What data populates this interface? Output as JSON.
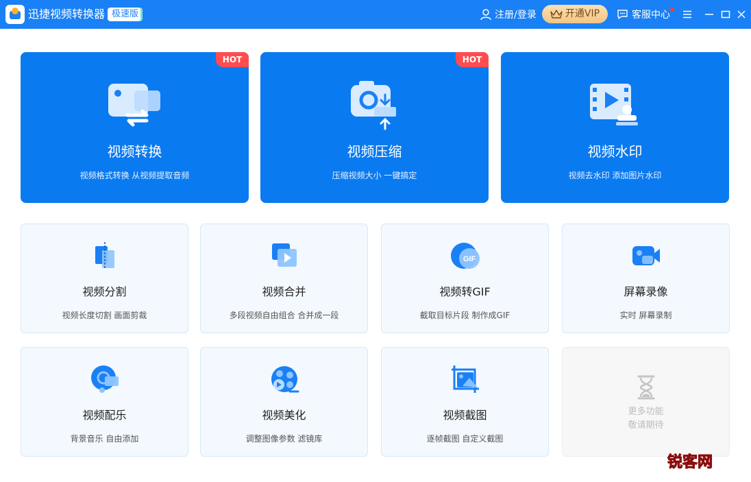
{
  "window": {
    "title": "迅捷视频转换器",
    "edition_badge": "极速版"
  },
  "header": {
    "login_label": "注册/登录",
    "vip_label": "开通VIP",
    "service_label": "客服中心"
  },
  "colors": {
    "title_bar": "#1a80f5",
    "big_card": "#0a7af0",
    "hot_badge": "#ff4d4f",
    "small_card_bg": "#f3f9fe",
    "vip_gold": "#f2c584"
  },
  "feature_cards": [
    {
      "title": "视频转换",
      "desc": "视频格式转换 从视频提取音频",
      "badge": "HOT",
      "icon": "video-convert-icon"
    },
    {
      "title": "视频压缩",
      "desc": "压缩视频大小 一键搞定",
      "badge": "HOT",
      "icon": "video-compress-icon"
    },
    {
      "title": "视频水印",
      "desc": "视频去水印 添加图片水印",
      "icon": "video-watermark-icon"
    }
  ],
  "tool_cards": [
    {
      "title": "视频分割",
      "desc": "视频长度切割 画面剪裁",
      "icon": "video-split-icon"
    },
    {
      "title": "视频合并",
      "desc": "多段视频自由组合 合并成一段",
      "icon": "video-merge-icon"
    },
    {
      "title": "视频转GIF",
      "desc": "截取目标片段 制作成GIF",
      "icon": "gif-icon"
    },
    {
      "title": "屏幕录像",
      "desc": "实时 屏幕录制",
      "icon": "screen-record-icon"
    },
    {
      "title": "视频配乐",
      "desc": "背景音乐 自由添加",
      "icon": "music-icon"
    },
    {
      "title": "视频美化",
      "desc": "调整图像参数 滤镜库",
      "icon": "video-beautify-icon"
    },
    {
      "title": "视频截图",
      "desc": "逐帧截图 自定义截图",
      "icon": "screenshot-icon"
    },
    {
      "title": "更多功能",
      "desc": "敬请期待",
      "icon": "hourglass-icon"
    }
  ],
  "watermark_text": "锐客网"
}
